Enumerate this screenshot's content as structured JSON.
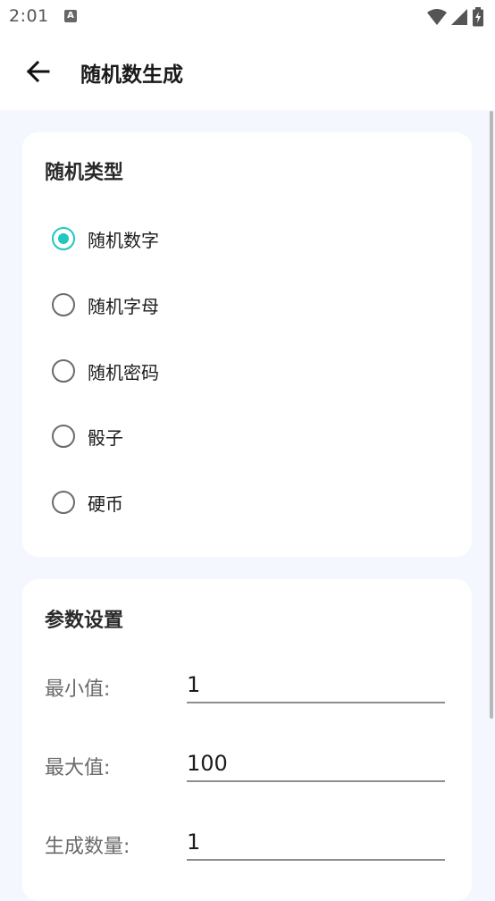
{
  "status_bar": {
    "time": "2:01",
    "notification_icon": "A",
    "right_icons": [
      "wifi-icon",
      "signal-icon",
      "battery-charging-icon"
    ]
  },
  "app_bar": {
    "back_icon": "arrow-left-icon",
    "title": "随机数生成"
  },
  "random_type": {
    "title": "随机类型",
    "options": [
      {
        "label": "随机数字",
        "checked": true
      },
      {
        "label": "随机字母",
        "checked": false
      },
      {
        "label": "随机密码",
        "checked": false
      },
      {
        "label": "骰子",
        "checked": false
      },
      {
        "label": "硬币",
        "checked": false
      }
    ]
  },
  "params": {
    "title": "参数设置",
    "min_label": "最小值:",
    "min_value": "1",
    "max_label": "最大值:",
    "max_value": "100",
    "count_label": "生成数量:",
    "count_value": "1"
  },
  "colors": {
    "accent": "#1ec8c0",
    "background": "#f4f7fd",
    "card": "#ffffff"
  }
}
